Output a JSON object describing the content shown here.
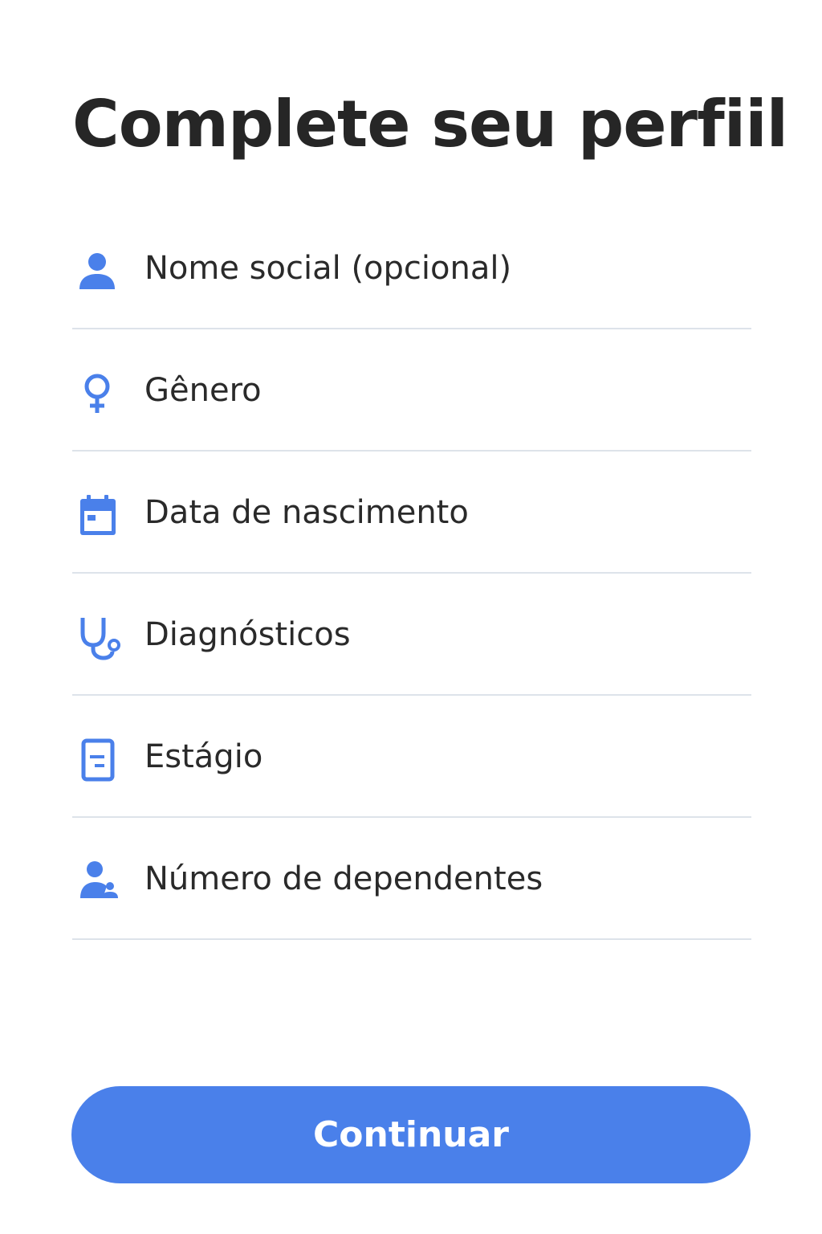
{
  "header": {
    "title": "Complete seu perfiil"
  },
  "theme": {
    "accent_color": "#4a80ea",
    "divider_color": "#dde3ea",
    "text_color": "#262626"
  },
  "form": {
    "fields": [
      {
        "label": "Nome social (opcional)",
        "icon": "person-icon"
      },
      {
        "label": "Gênero",
        "icon": "female-symbol-icon"
      },
      {
        "label": "Data de nascimento",
        "icon": "calendar-icon"
      },
      {
        "label": "Diagnósticos",
        "icon": "stethoscope-icon"
      },
      {
        "label": "Estágio",
        "icon": "document-icon"
      },
      {
        "label": "Número de dependentes",
        "icon": "person-with-dependent-icon"
      }
    ]
  },
  "footer": {
    "continue_label": "Continuar"
  }
}
